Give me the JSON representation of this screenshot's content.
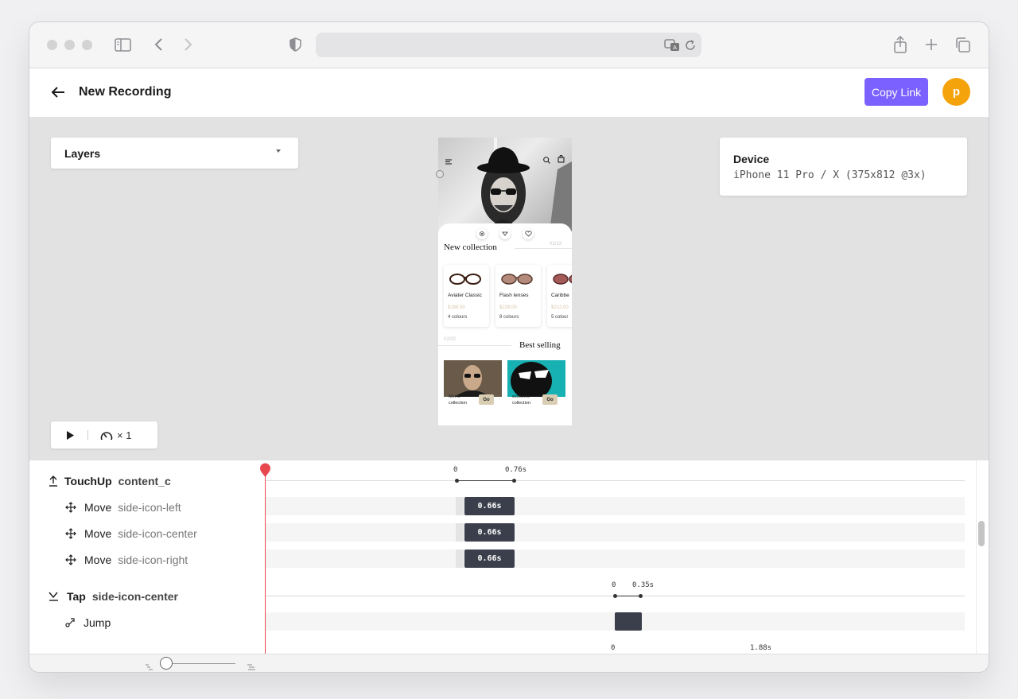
{
  "header": {
    "title": "New Recording",
    "copy_link": "Copy Link",
    "avatar_initial": "p"
  },
  "layers": {
    "label": "Layers"
  },
  "device": {
    "label": "Device",
    "value": "iPhone 11 Pro / X (375x812 @3x)"
  },
  "playback": {
    "speed": "× 1"
  },
  "phone": {
    "section1": "New collection",
    "page1": "01/13",
    "cards": [
      {
        "name": "Aviater Classic",
        "price": "$188.00",
        "colours": "4 colours"
      },
      {
        "name": "Flash lenses",
        "price": "$228.00",
        "colours": "8 colours"
      },
      {
        "name": "Caribbe",
        "price": "$212.00",
        "colours": "5 colour"
      }
    ],
    "page2": "02/02",
    "section2": "Best selling",
    "collections": [
      {
        "label1": "Men's",
        "label2": "collection",
        "go": "Go"
      },
      {
        "label1": "women's",
        "label2": "collection",
        "go": "Go"
      }
    ]
  },
  "timeline": {
    "rows": [
      {
        "name": "TouchUp",
        "target": "content_c"
      },
      {
        "name": "Move",
        "target": "side-icon-left",
        "duration": "0.66s"
      },
      {
        "name": "Move",
        "target": "side-icon-center",
        "duration": "0.66s"
      },
      {
        "name": "Move",
        "target": "side-icon-right",
        "duration": "0.66s"
      },
      {
        "name": "Tap",
        "target": "side-icon-center"
      },
      {
        "name": "Jump",
        "target": ""
      }
    ],
    "scale1": {
      "start": "0",
      "end": "0.76s"
    },
    "scale2": {
      "start": "0",
      "end": "0.35s"
    },
    "scale3": {
      "start": "0",
      "end": "1.88s"
    }
  },
  "colors": {
    "accent": "#7b61ff",
    "avatar": "#f5a30a",
    "playhead": "#e8474e",
    "bar": "#3a3f4b"
  }
}
